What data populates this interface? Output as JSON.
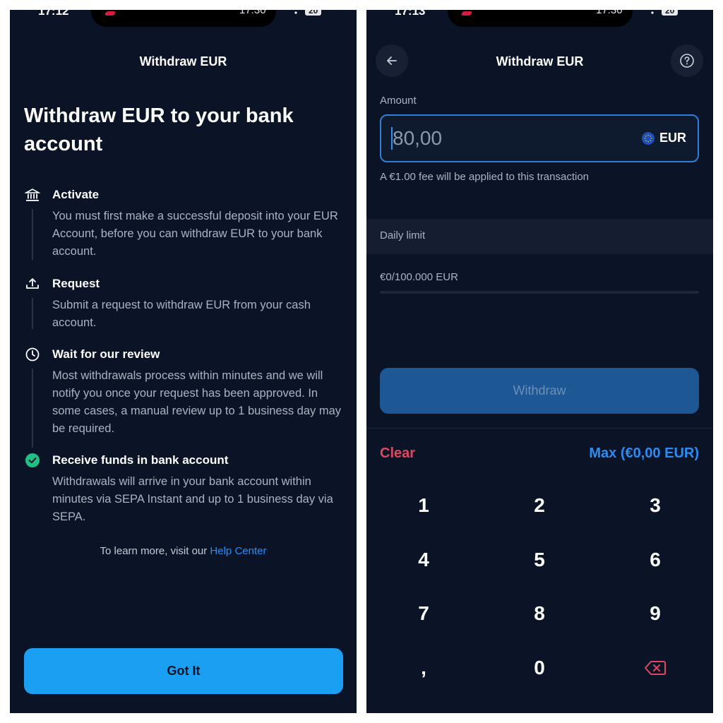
{
  "left": {
    "status": {
      "time": "17:12",
      "clock": "17:30",
      "battery": "20"
    },
    "header_title": "Withdraw EUR",
    "hero_title": "Withdraw EUR to your bank account",
    "steps": [
      {
        "icon": "bank-icon",
        "title": "Activate",
        "desc": "You must first make a successful deposit into your EUR Account, before you can withdraw EUR to your bank account."
      },
      {
        "icon": "upload-icon",
        "title": "Request",
        "desc": "Submit a request to withdraw EUR from your cash account."
      },
      {
        "icon": "clock-icon",
        "title": "Wait for our review",
        "desc": "Most withdrawals process within minutes and we will notify you once your request has been approved. In some cases, a manual review up to 1 business day may be required."
      },
      {
        "icon": "check-circle-icon",
        "title": "Receive funds in bank account",
        "desc": "Withdrawals will arrive in your bank account within minutes via SEPA Instant and up to 1 business day via SEPA."
      }
    ],
    "learn_more_text": "To learn more, visit our ",
    "help_center_link": "Help Center",
    "got_it_label": "Got It"
  },
  "right": {
    "status": {
      "time": "17:13",
      "clock": "17:30",
      "battery": "20"
    },
    "header_title": "Withdraw EUR",
    "amount_label": "Amount",
    "amount_value": "80,00",
    "currency": "EUR",
    "fee_note": "A €1.00 fee will be applied to this transaction",
    "daily_limit_label": "Daily limit",
    "daily_limit_value": "€0/100.000 EUR",
    "withdraw_label": "Withdraw",
    "clear_label": "Clear",
    "max_label": "Max (€0,00 EUR)",
    "keys": [
      "1",
      "2",
      "3",
      "4",
      "5",
      "6",
      "7",
      "8",
      "9",
      ",",
      "0"
    ]
  },
  "colors": {
    "background": "#0b1426",
    "primary_button": "#1b9ff2",
    "link": "#2b8cf5",
    "danger": "#e0475f",
    "success": "#1fbf85"
  }
}
